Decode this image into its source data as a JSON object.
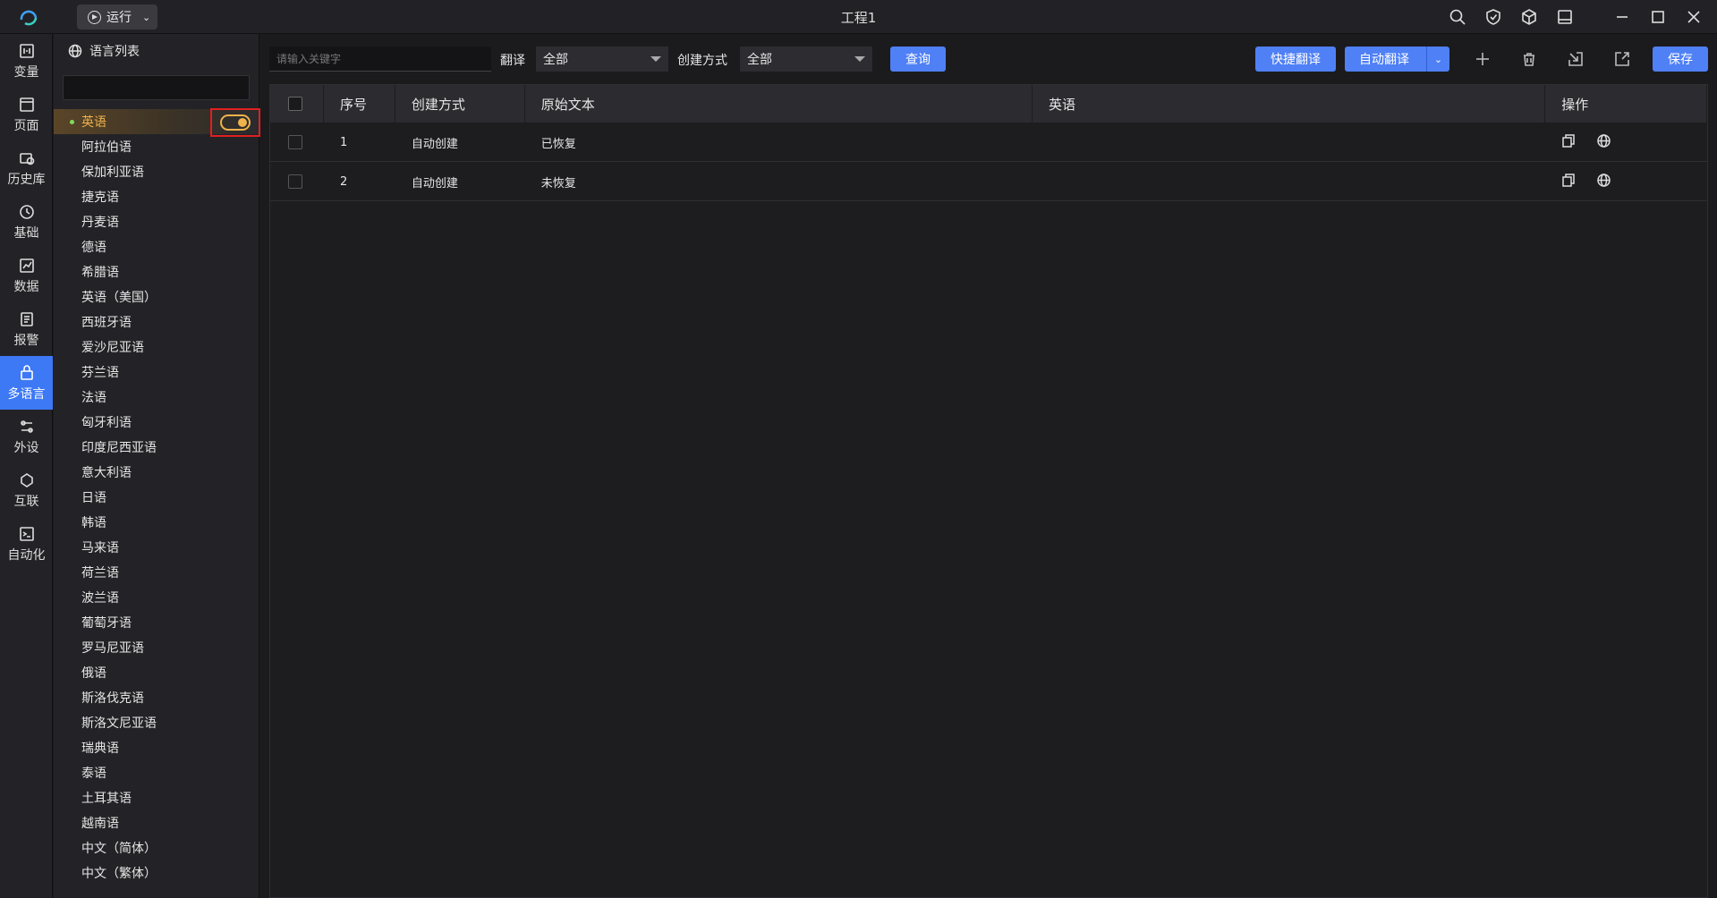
{
  "titlebar": {
    "run_label": "运行",
    "title": "工程1"
  },
  "rail": [
    {
      "label": "变量",
      "icon": "variable-icon"
    },
    {
      "label": "页面",
      "icon": "page-icon"
    },
    {
      "label": "历史库",
      "icon": "history-db-icon"
    },
    {
      "label": "基础",
      "icon": "basic-icon"
    },
    {
      "label": "数据",
      "icon": "data-icon"
    },
    {
      "label": "报警",
      "icon": "alarm-icon"
    },
    {
      "label": "多语言",
      "icon": "multilang-icon",
      "active": true
    },
    {
      "label": "外设",
      "icon": "peripheral-icon"
    },
    {
      "label": "互联",
      "icon": "interconnect-icon"
    },
    {
      "label": "自动化",
      "icon": "automation-icon"
    }
  ],
  "lang_panel": {
    "title": "语言列表",
    "search_value": "",
    "languages": [
      "英语",
      "阿拉伯语",
      "保加利亚语",
      "捷克语",
      "丹麦语",
      "德语",
      "希腊语",
      "英语（美国）",
      "西班牙语",
      "爱沙尼亚语",
      "芬兰语",
      "法语",
      "匈牙利语",
      "印度尼西亚语",
      "意大利语",
      "日语",
      "韩语",
      "马来语",
      "荷兰语",
      "波兰语",
      "葡萄牙语",
      "罗马尼亚语",
      "俄语",
      "斯洛伐克语",
      "斯洛文尼亚语",
      "瑞典语",
      "泰语",
      "土耳其语",
      "越南语",
      "中文（简体）",
      "中文（繁体）"
    ],
    "selected_index": 0,
    "toggle_on": true
  },
  "toolbar": {
    "keyword_placeholder": "请输入关键字",
    "translate_label": "翻译",
    "translate_value": "全部",
    "create_label": "创建方式",
    "create_value": "全部",
    "query_label": "查询",
    "quick_translate_label": "快捷翻译",
    "auto_translate_label": "自动翻译",
    "save_label": "保存"
  },
  "table": {
    "headers": {
      "seq": "序号",
      "create": "创建方式",
      "original": "原始文本",
      "english": "英语",
      "ops": "操作"
    },
    "rows": [
      {
        "seq": "1",
        "create": "自动创建",
        "original": "已恢复",
        "english": ""
      },
      {
        "seq": "2",
        "create": "自动创建",
        "original": "未恢复",
        "english": ""
      }
    ]
  },
  "colors": {
    "accent": "#4f80f5",
    "selected_text": "#f0b24a",
    "highlight_box": "#e02020"
  }
}
